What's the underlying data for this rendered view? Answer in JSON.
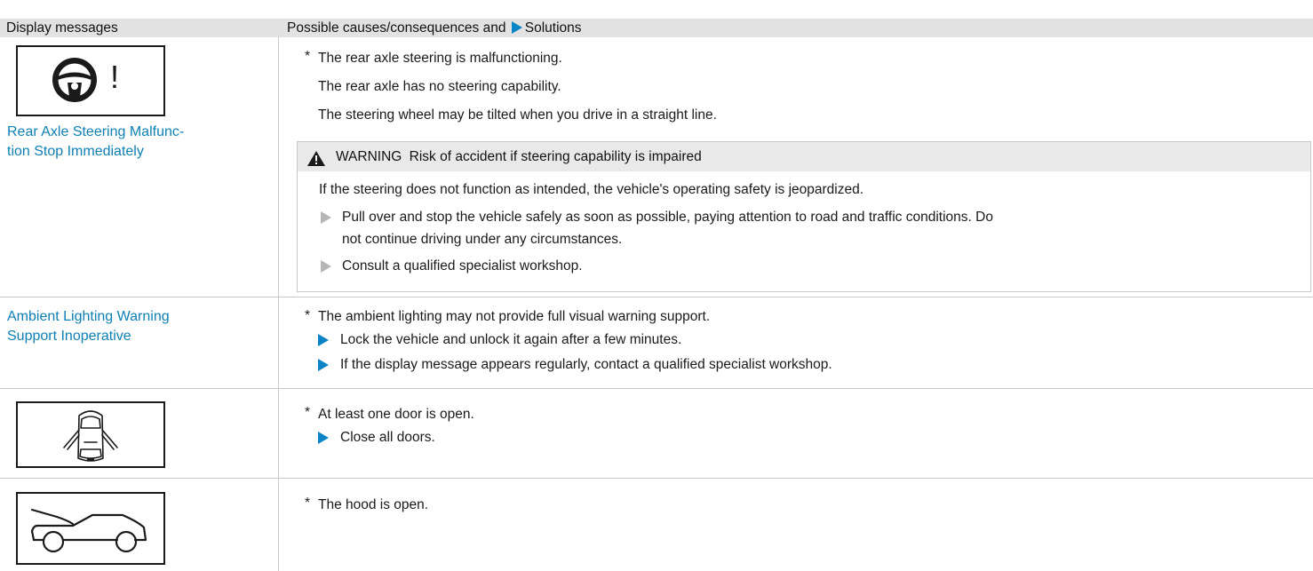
{
  "header": {
    "col1": "Display messages",
    "col2_before": "Possible causes/consequences and",
    "col2_after": "Solutions"
  },
  "rows": [
    {
      "icon": "steering-wheel-exclamation-icon",
      "message": "Rear Axle Steering Malfunc-tion Stop Immediately",
      "message_line1": "Rear Axle Steering Malfunc-",
      "message_line2": "tion Stop Immediately",
      "causes": [
        "The rear axle steering is malfunctioning.",
        "The rear axle has no steering capability.",
        "The steering wheel may be tilted when you drive in a straight line."
      ],
      "warning": {
        "label": "WARNING",
        "title": "Risk of accident if steering capability is impaired",
        "text": "If the steering does not function as intended, the vehicle's operating safety is jeopardized.",
        "steps": [
          {
            "line1": "Pull over and stop the vehicle safely as soon as possible, paying attention to road and traffic conditions. Do",
            "line2": "not continue driving under any circumstances."
          },
          {
            "line1": "Consult a qualified specialist workshop."
          }
        ]
      }
    },
    {
      "message_line1": "Ambient Lighting Warning",
      "message_line2": "Support Inoperative",
      "causes": [
        "The ambient lighting may not provide full visual warning support."
      ],
      "solutions": [
        "Lock the vehicle and unlock it again after a few minutes.",
        "If the display message appears regularly, contact a qualified specialist workshop."
      ]
    },
    {
      "icon": "car-door-open-icon",
      "causes": [
        "At least one door is open."
      ],
      "solutions": [
        "Close all doors."
      ]
    },
    {
      "icon": "hood-open-icon",
      "causes": [
        "The hood is open."
      ]
    }
  ],
  "marks": {
    "star": "*",
    "exclamation": "!"
  },
  "colors": {
    "accent_blue": "#0a84c5",
    "message_blue": "#0e7fb3",
    "header_bg": "#e2e2e2",
    "warning_bar_bg": "#e9e9e9",
    "grey_bullet": "#b6b6b6"
  }
}
